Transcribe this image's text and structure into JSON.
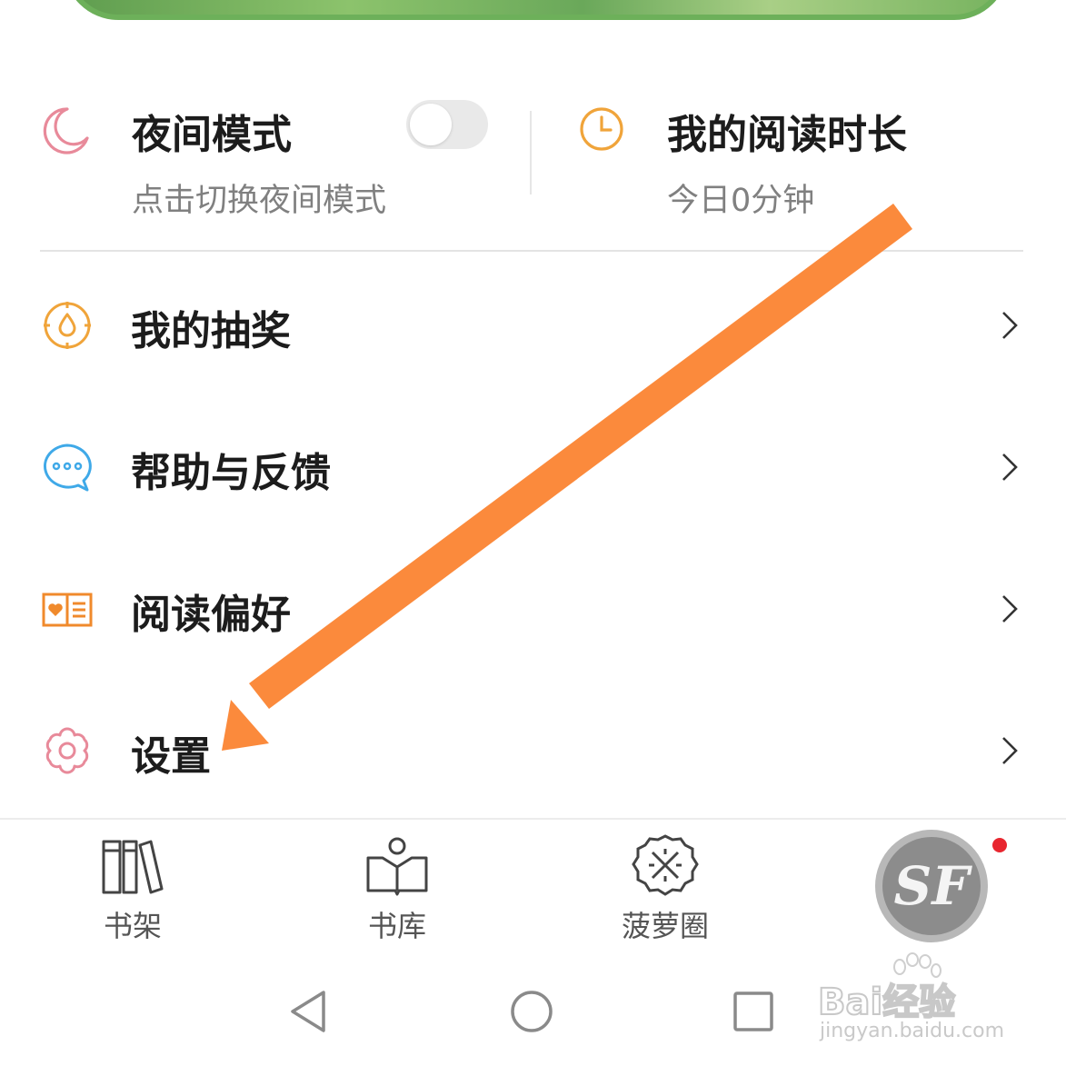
{
  "night_mode": {
    "title": "夜间模式",
    "subtitle": "点击切换夜间模式",
    "enabled": false
  },
  "reading_time": {
    "title": "我的阅读时长",
    "subtitle": "今日0分钟"
  },
  "menu": [
    {
      "label": "我的抽奖",
      "icon": "target-icon"
    },
    {
      "label": "帮助与反馈",
      "icon": "chat-bubble-icon"
    },
    {
      "label": "阅读偏好",
      "icon": "open-book-heart-icon"
    },
    {
      "label": "设置",
      "icon": "gear-icon"
    }
  ],
  "tabs": [
    {
      "label": "书架",
      "icon": "bookshelf-icon"
    },
    {
      "label": "书库",
      "icon": "book-library-icon"
    },
    {
      "label": "菠萝圈",
      "icon": "pineapple-circle-icon"
    }
  ],
  "avatar": {
    "text": "SF",
    "has_notification": true
  },
  "watermark": {
    "main": "Bai经验",
    "sub": "jingyan.baidu.com"
  },
  "colors": {
    "annotation_arrow": "#fb8a3c",
    "moon_icon": "#e88a9a",
    "clock_icon": "#f0a43a",
    "target_icon": "#f0a43a",
    "chat_icon": "#3fa9e8",
    "book_icon": "#f08a2c",
    "gear_icon": "#e88a9a",
    "notification_dot": "#e8262f"
  }
}
